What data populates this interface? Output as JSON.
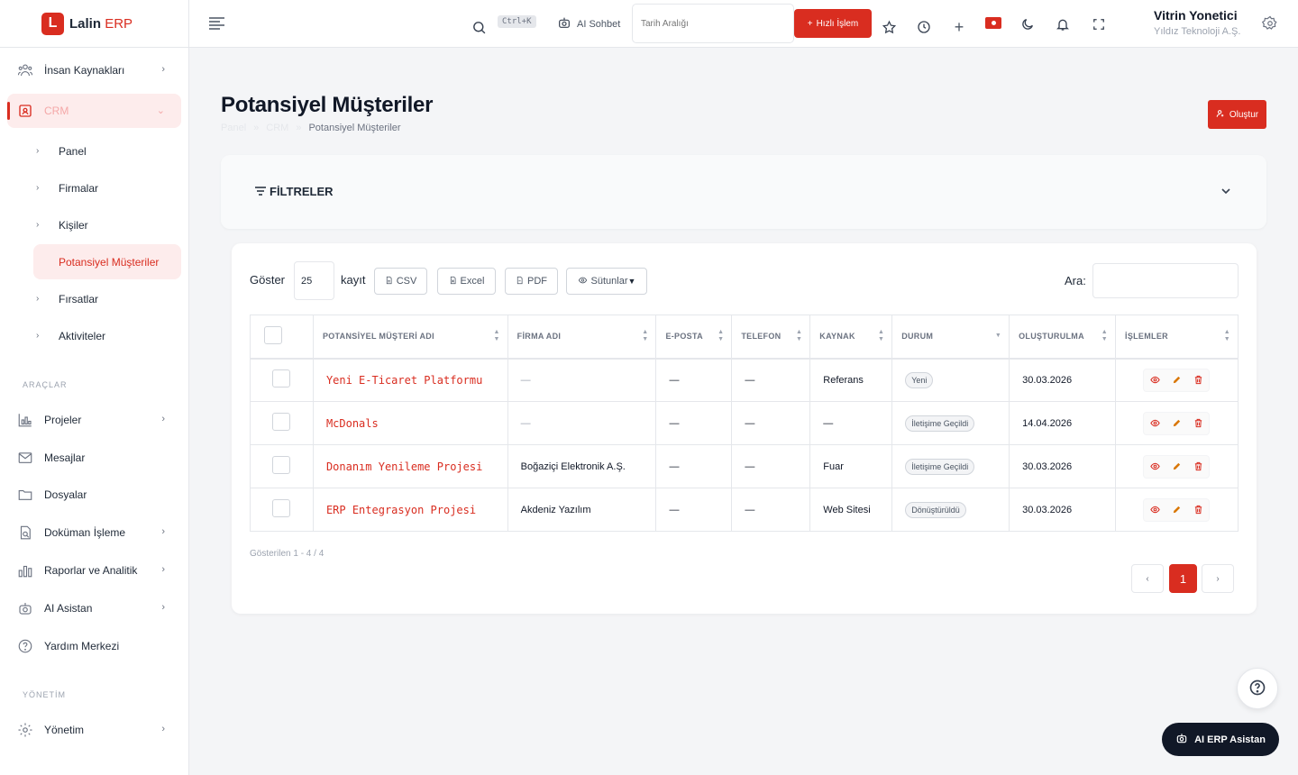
{
  "brand": {
    "letter": "L",
    "name": "Lalin",
    "suffix": "ERP"
  },
  "sidebar": {
    "top_items": [
      {
        "label": "İnsan Kaynakları"
      },
      {
        "label": "CRM"
      }
    ],
    "crm_sub_items": [
      {
        "label": "Panel"
      },
      {
        "label": "Firmalar"
      },
      {
        "label": "Kişiler"
      },
      {
        "label": "Potansiyel Müşteriler"
      },
      {
        "label": "Fırsatlar"
      },
      {
        "label": "Aktiviteler"
      }
    ],
    "tools_section": "ARAÇLAR",
    "tool_items": [
      {
        "label": "Projeler"
      },
      {
        "label": "Mesajlar"
      },
      {
        "label": "Dosyalar"
      },
      {
        "label": "Doküman İşleme"
      },
      {
        "label": "Raporlar ve Analitik"
      },
      {
        "label": "AI Asistan"
      },
      {
        "label": "Yardım Merkezi"
      }
    ],
    "admin_section": "YÖNETİM",
    "admin_items": [
      {
        "label": "Yönetim"
      }
    ]
  },
  "topbar": {
    "search_shortcut": "Ctrl+K",
    "ai_chat_label": "AI Sohbet",
    "date_range_placeholder": "Tarih Aralığı",
    "quick_action_label": "Hızlı İşlem",
    "user": {
      "name": "Vitrin Yonetici",
      "company": "Yıldız Teknoloji A.Ş."
    }
  },
  "page": {
    "title": "Potansiyel Müşteriler",
    "breadcrumb": [
      "Panel",
      "CRM",
      "Potansiyel Müşteriler"
    ],
    "create_label": "Oluştur"
  },
  "filters": {
    "title": "FİLTRELER"
  },
  "table_toolbar": {
    "show_label": "Göster",
    "page_length": "25",
    "records_label": "kayıt",
    "csv_label": "CSV",
    "excel_label": "Excel",
    "pdf_label": "PDF",
    "columns_label": "Sütunlar",
    "search_label": "Ara:"
  },
  "table": {
    "headers": [
      "POTANSİYEL MÜŞTERİ ADI",
      "FİRMA ADI",
      "E-POSTA",
      "TELEFON",
      "KAYNAK",
      "DURUM",
      "OLUŞTURULMA",
      "İŞLEMLER"
    ],
    "rows": [
      {
        "name": "Yeni E-Ticaret Platformu",
        "company": "—",
        "email": "—",
        "phone": "—",
        "source": "Referans",
        "status": "Yeni",
        "created": "30.03.2026"
      },
      {
        "name": "McDonals",
        "company": "—",
        "email": "—",
        "phone": "—",
        "source": "—",
        "status": "İletişime Geçildi",
        "created": "14.04.2026"
      },
      {
        "name": "Donanım Yenileme Projesi",
        "company": "Boğaziçi Elektronik A.Ş.",
        "email": "—",
        "phone": "—",
        "source": "Fuar",
        "status": "İletişime Geçildi",
        "created": "30.03.2026"
      },
      {
        "name": "ERP Entegrasyon Projesi",
        "company": "Akdeniz Yazılım",
        "email": "—",
        "phone": "—",
        "source": "Web Sitesi",
        "status": "Dönüştürüldü",
        "created": "30.03.2026"
      }
    ]
  },
  "pagination": {
    "info": "Gösterilen 1 - 4 / 4",
    "prev": "‹",
    "current": "1",
    "next": "›"
  },
  "floating": {
    "help_symbol": "?",
    "ai_assistant_label": "AI ERP Asistan"
  },
  "colors": {
    "accent": "#d92d20",
    "accent_soft": "#fdecec",
    "dark": "#111827"
  },
  "icons": [
    "menu-icon",
    "search-icon",
    "robot-icon",
    "plus-icon",
    "star-icon",
    "clock-icon",
    "flag-icon",
    "moon-icon",
    "bell-icon",
    "fullscreen-icon",
    "settings-icon",
    "users-icon",
    "crm-icon",
    "chart-icon",
    "mail-icon",
    "folder-icon",
    "document-scan-icon",
    "bar-chart-icon",
    "help-icon",
    "gear-icon",
    "filter-icon",
    "chevron-down-icon",
    "eye-icon",
    "pencil-icon",
    "trash-icon",
    "file-icon"
  ]
}
